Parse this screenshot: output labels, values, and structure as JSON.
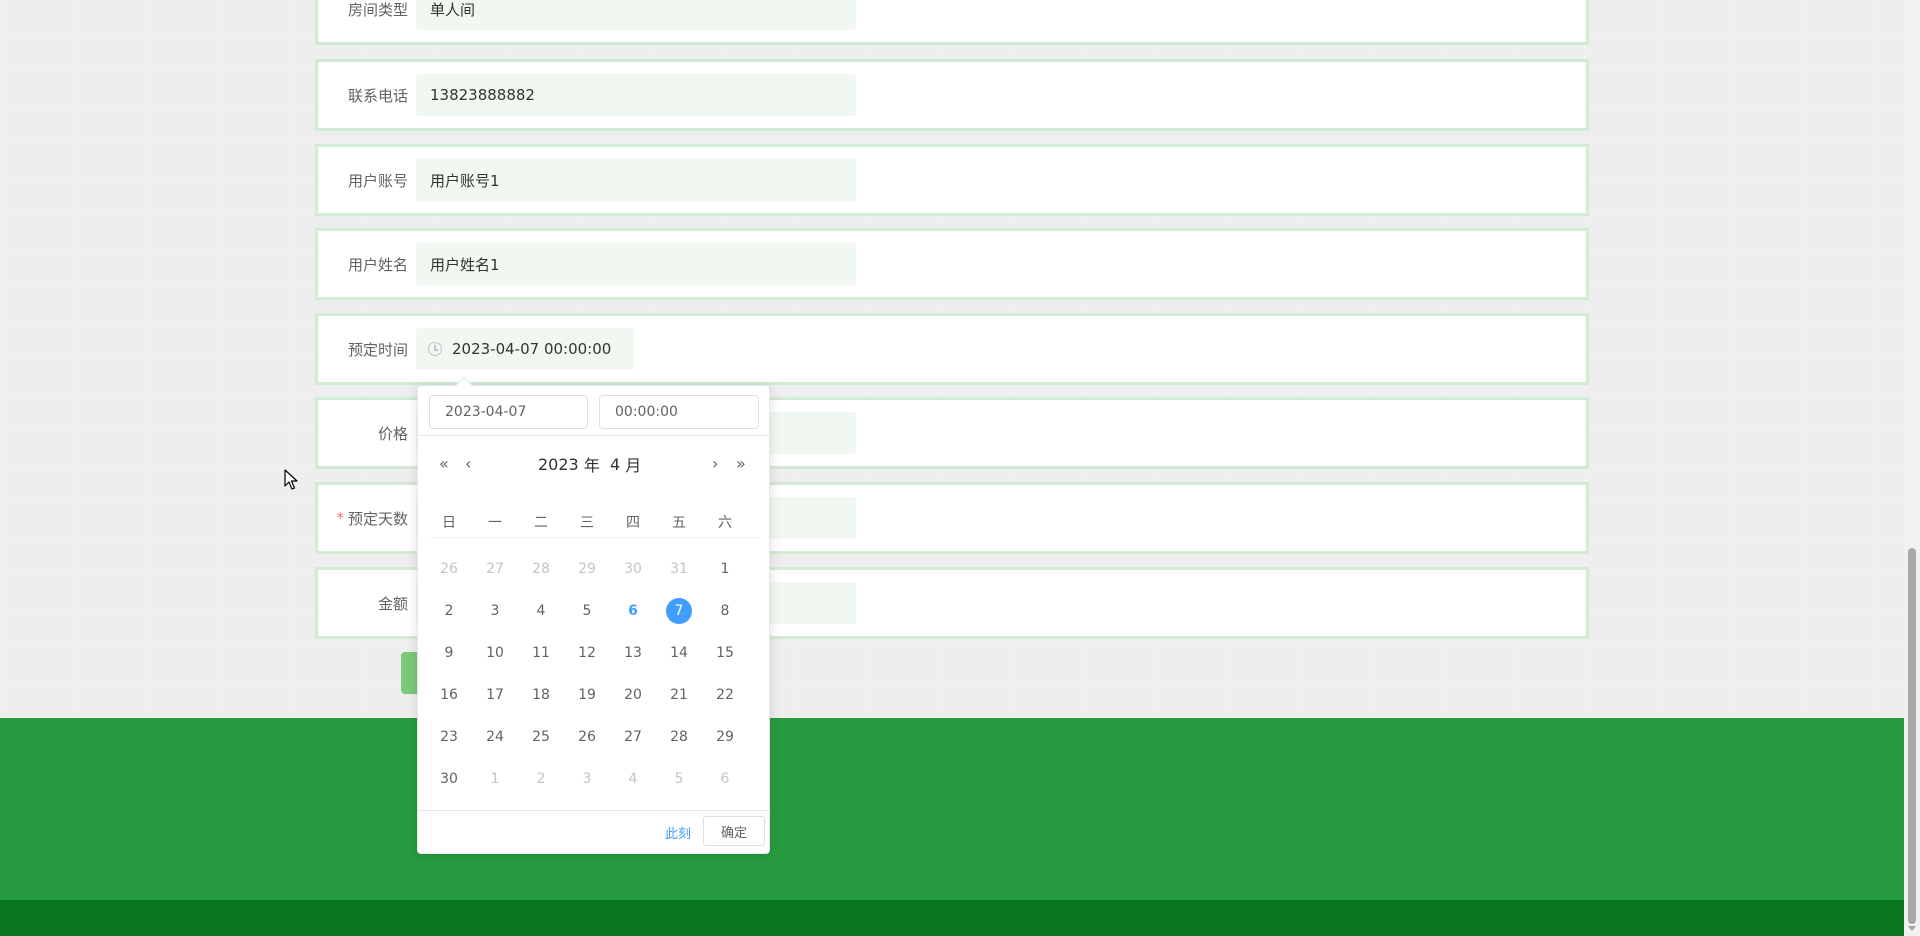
{
  "form": {
    "rows": [
      {
        "label": "房间类型",
        "value": "单人间",
        "required": false
      },
      {
        "label": "联系电话",
        "value": "13823888882",
        "required": false
      },
      {
        "label": "用户账号",
        "value": "用户账号1",
        "required": false
      },
      {
        "label": "用户姓名",
        "value": "用户姓名1",
        "required": false
      },
      {
        "label": "预定时间",
        "value": "2023-04-07 00:00:00",
        "required": false
      },
      {
        "label": "价格",
        "value": "",
        "required": false
      },
      {
        "label": "预定天数",
        "value": "",
        "required": true
      },
      {
        "label": "金额",
        "value": "",
        "required": false
      }
    ],
    "required_mark": "*"
  },
  "icons": {
    "date_prefix": "clock-icon",
    "cursor": "arrow-cursor-icon",
    "prev_year": "double-left-icon",
    "prev_month": "left-icon",
    "next_month": "right-icon",
    "next_year": "double-right-icon"
  },
  "picker": {
    "date_value": "2023-04-07",
    "time_value": "00:00:00",
    "year": "2023",
    "year_suffix": "年",
    "month": "4",
    "month_suffix": "月",
    "nav_symbols": {
      "prev_year": "«",
      "prev_month": "‹",
      "next_month": "›",
      "next_year": "»"
    },
    "weekdays": [
      "日",
      "一",
      "二",
      "三",
      "四",
      "五",
      "六"
    ],
    "weeks": [
      [
        {
          "d": "26",
          "s": "other"
        },
        {
          "d": "27",
          "s": "other"
        },
        {
          "d": "28",
          "s": "other"
        },
        {
          "d": "29",
          "s": "other"
        },
        {
          "d": "30",
          "s": "other"
        },
        {
          "d": "31",
          "s": "other"
        },
        {
          "d": "1",
          "s": ""
        }
      ],
      [
        {
          "d": "2",
          "s": ""
        },
        {
          "d": "3",
          "s": ""
        },
        {
          "d": "4",
          "s": ""
        },
        {
          "d": "5",
          "s": ""
        },
        {
          "d": "6",
          "s": "today"
        },
        {
          "d": "7",
          "s": "selected"
        },
        {
          "d": "8",
          "s": ""
        }
      ],
      [
        {
          "d": "9",
          "s": ""
        },
        {
          "d": "10",
          "s": ""
        },
        {
          "d": "11",
          "s": ""
        },
        {
          "d": "12",
          "s": ""
        },
        {
          "d": "13",
          "s": ""
        },
        {
          "d": "14",
          "s": ""
        },
        {
          "d": "15",
          "s": ""
        }
      ],
      [
        {
          "d": "16",
          "s": ""
        },
        {
          "d": "17",
          "s": ""
        },
        {
          "d": "18",
          "s": ""
        },
        {
          "d": "19",
          "s": ""
        },
        {
          "d": "20",
          "s": ""
        },
        {
          "d": "21",
          "s": ""
        },
        {
          "d": "22",
          "s": ""
        }
      ],
      [
        {
          "d": "23",
          "s": ""
        },
        {
          "d": "24",
          "s": ""
        },
        {
          "d": "25",
          "s": ""
        },
        {
          "d": "26",
          "s": ""
        },
        {
          "d": "27",
          "s": ""
        },
        {
          "d": "28",
          "s": ""
        },
        {
          "d": "29",
          "s": ""
        }
      ],
      [
        {
          "d": "30",
          "s": ""
        },
        {
          "d": "1",
          "s": "other"
        },
        {
          "d": "2",
          "s": "other"
        },
        {
          "d": "3",
          "s": "other"
        },
        {
          "d": "4",
          "s": "other"
        },
        {
          "d": "5",
          "s": "other"
        },
        {
          "d": "6",
          "s": "other"
        }
      ]
    ],
    "now_label": "此刻",
    "ok_label": "确定"
  },
  "colors": {
    "accent": "#409eff",
    "footer": "#279b3f",
    "footer_bottom": "#087720",
    "row_border": "#d3ebd3",
    "input_bg": "#f1f8f1",
    "required": "#f56c6c"
  }
}
